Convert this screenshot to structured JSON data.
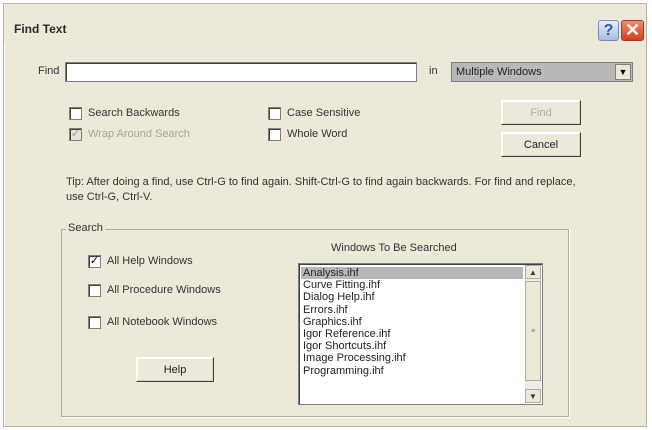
{
  "window": {
    "title": "Find Text"
  },
  "titlebar": {
    "help_label": "?",
    "close_label": "✕"
  },
  "find": {
    "label": "Find",
    "value": "",
    "in_label": "in",
    "scope_selected": "Multiple Windows"
  },
  "options": {
    "search_backwards": {
      "label": "Search Backwards",
      "checked": false
    },
    "wrap_around": {
      "label": "Wrap Around Search",
      "checked": true,
      "disabled": true
    },
    "case_sensitive": {
      "label": "Case Sensitive",
      "checked": false
    },
    "whole_word": {
      "label": "Whole Word",
      "checked": false
    }
  },
  "buttons": {
    "find": "Find",
    "cancel": "Cancel",
    "help": "Help"
  },
  "tip": "Tip: After doing a find, use Ctrl-G to find again. Shift-Ctrl-G to find again backwards. For find and replace, use Ctrl-G, Ctrl-V.",
  "search_group": {
    "title": "Search",
    "all_help": {
      "label": "All Help Windows",
      "checked": true
    },
    "all_procedure": {
      "label": "All Procedure Windows",
      "checked": false
    },
    "all_notebook": {
      "label": "All Notebook Windows",
      "checked": false
    }
  },
  "windows_list": {
    "title": "Windows To Be Searched",
    "items": [
      "Analysis.ihf",
      "Curve Fitting.ihf",
      "Dialog Help.ihf",
      "Errors.ihf",
      "Graphics.ihf",
      "Igor Reference.ihf",
      "Igor Shortcuts.ihf",
      "Image Processing.ihf",
      "Programming.ihf"
    ],
    "selected_index": 0
  }
}
